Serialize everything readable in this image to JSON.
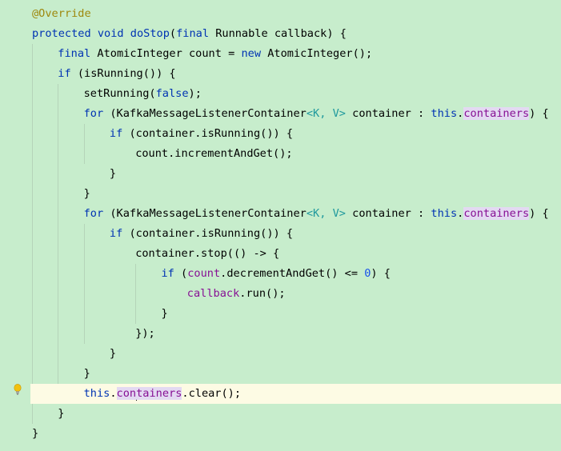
{
  "editor": {
    "lines": [
      {
        "indent": 0,
        "tokens": [
          {
            "t": "@Override",
            "c": "ann"
          }
        ]
      },
      {
        "indent": 0,
        "tokens": [
          {
            "t": "protected",
            "c": "kw"
          },
          {
            "t": " "
          },
          {
            "t": "void",
            "c": "kw"
          },
          {
            "t": " "
          },
          {
            "t": "doStop",
            "c": "kw"
          },
          {
            "t": "("
          },
          {
            "t": "final",
            "c": "kw"
          },
          {
            "t": " Runnable callback) {"
          }
        ]
      },
      {
        "indent": 1,
        "tokens": [
          {
            "t": "final",
            "c": "kw"
          },
          {
            "t": " AtomicInteger count = "
          },
          {
            "t": "new",
            "c": "kw"
          },
          {
            "t": " AtomicInteger();"
          }
        ]
      },
      {
        "indent": 1,
        "tokens": [
          {
            "t": "if",
            "c": "kw"
          },
          {
            "t": " (isRunning()) {"
          }
        ]
      },
      {
        "indent": 2,
        "tokens": [
          {
            "t": "setRunning("
          },
          {
            "t": "false",
            "c": "kw"
          },
          {
            "t": ");"
          }
        ]
      },
      {
        "indent": 2,
        "tokens": [
          {
            "t": "for",
            "c": "kw"
          },
          {
            "t": " (KafkaMessageListenerContainer"
          },
          {
            "t": "<K, V>",
            "c": "gen"
          },
          {
            "t": " container : "
          },
          {
            "t": "this",
            "c": "kw"
          },
          {
            "t": "."
          },
          {
            "t": "containers",
            "c": "fld hl"
          },
          {
            "t": ") {"
          }
        ]
      },
      {
        "indent": 3,
        "tokens": [
          {
            "t": "if",
            "c": "kw"
          },
          {
            "t": " (container.isRunning()) {"
          }
        ]
      },
      {
        "indent": 4,
        "tokens": [
          {
            "t": "count.incrementAndGet();"
          }
        ]
      },
      {
        "indent": 3,
        "tokens": [
          {
            "t": "}"
          }
        ]
      },
      {
        "indent": 2,
        "tokens": [
          {
            "t": "}"
          }
        ]
      },
      {
        "indent": 2,
        "tokens": [
          {
            "t": "for",
            "c": "kw"
          },
          {
            "t": " (KafkaMessageListenerContainer"
          },
          {
            "t": "<K, V>",
            "c": "gen"
          },
          {
            "t": " container : "
          },
          {
            "t": "this",
            "c": "kw"
          },
          {
            "t": "."
          },
          {
            "t": "containers",
            "c": "fld hl"
          },
          {
            "t": ") {"
          }
        ]
      },
      {
        "indent": 3,
        "tokens": [
          {
            "t": "if",
            "c": "kw"
          },
          {
            "t": " (container.isRunning()) {"
          }
        ]
      },
      {
        "indent": 4,
        "tokens": [
          {
            "t": "container.stop(() -> {"
          }
        ]
      },
      {
        "indent": 5,
        "tokens": [
          {
            "t": "if",
            "c": "kw"
          },
          {
            "t": " ("
          },
          {
            "t": "count",
            "c": "fld"
          },
          {
            "t": ".decrementAndGet() <= "
          },
          {
            "t": "0",
            "c": "num"
          },
          {
            "t": ") {"
          }
        ]
      },
      {
        "indent": 6,
        "tokens": [
          {
            "t": "callback",
            "c": "fld"
          },
          {
            "t": ".run();"
          }
        ]
      },
      {
        "indent": 5,
        "tokens": [
          {
            "t": "}"
          }
        ]
      },
      {
        "indent": 4,
        "tokens": [
          {
            "t": "});"
          }
        ]
      },
      {
        "indent": 3,
        "tokens": [
          {
            "t": "}"
          }
        ]
      },
      {
        "indent": 2,
        "tokens": [
          {
            "t": "}"
          }
        ]
      },
      {
        "indent": 2,
        "current": true,
        "tokens": [
          {
            "t": "this",
            "c": "kw"
          },
          {
            "t": "."
          },
          {
            "t": "con",
            "c": "fld hl"
          },
          {
            "t": "|caret|"
          },
          {
            "t": "tainers",
            "c": "fld hl"
          },
          {
            "t": ".clear();"
          }
        ]
      },
      {
        "indent": 1,
        "tokens": [
          {
            "t": "}"
          }
        ]
      },
      {
        "indent": 0,
        "tokens": [
          {
            "t": "}"
          }
        ]
      }
    ],
    "intention_icon": "lightbulb-icon",
    "colors": {
      "background": "#c7edcc",
      "current_line": "#fdfbe4",
      "keyword": "#0033b3",
      "field": "#871094",
      "annotation": "#9e880d",
      "highlight": "#e3d9f2"
    }
  }
}
